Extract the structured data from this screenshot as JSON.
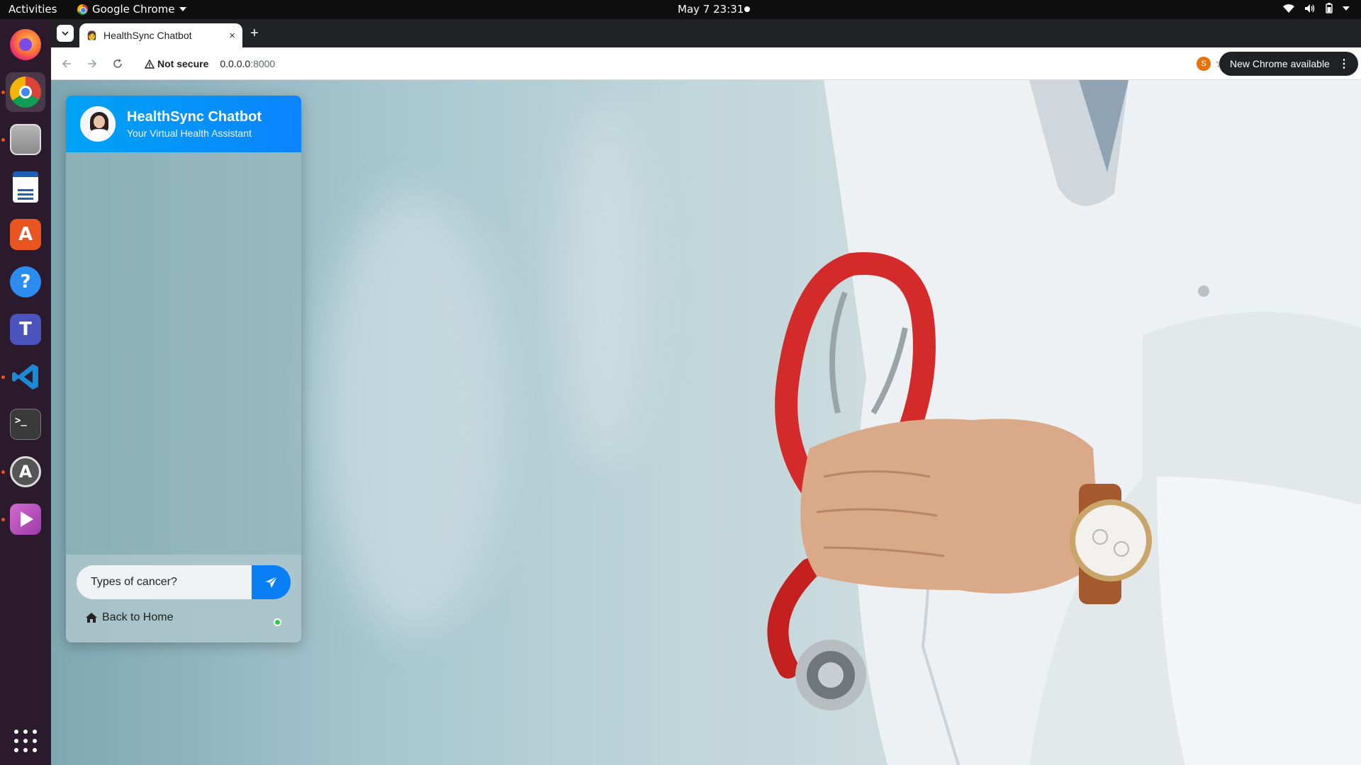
{
  "topbar": {
    "activities": "Activities",
    "app_name": "Google Chrome",
    "clock": "May 7  23:31"
  },
  "dock": {
    "items": [
      {
        "name": "firefox-icon"
      },
      {
        "name": "chrome-icon"
      },
      {
        "name": "files-icon"
      },
      {
        "name": "writer-icon"
      },
      {
        "name": "app-center-icon"
      },
      {
        "name": "help-icon"
      },
      {
        "name": "teams-icon"
      },
      {
        "name": "vscode-icon"
      },
      {
        "name": "terminal-icon"
      },
      {
        "name": "software-updater-icon"
      },
      {
        "name": "media-player-icon"
      }
    ]
  },
  "browser": {
    "tab_title": "HealthSync Chatbot",
    "tab_close": "×",
    "new_tab": "+",
    "security_label": "Not secure",
    "url_host": "0.0.0.0",
    "url_port": ":8000",
    "profile_initial": "S",
    "update_button": "New Chrome available"
  },
  "chat": {
    "title": "HealthSync Chatbot",
    "subtitle": "Your Virtual Health Assistant",
    "input_value": "Types of cancer?",
    "back_home": "Back to Home",
    "accent_color": "#0a84ff",
    "status_color": "#2ecc40"
  }
}
